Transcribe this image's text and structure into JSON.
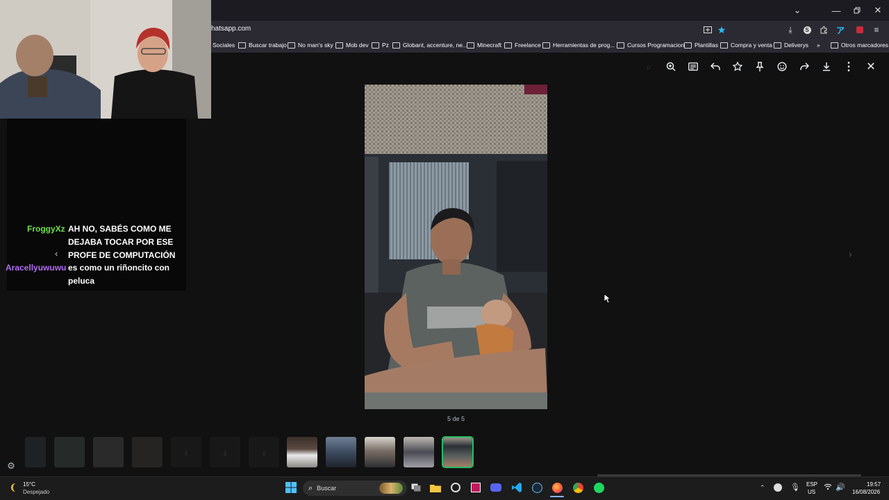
{
  "browser": {
    "url": "hatsapp.com",
    "bookmarks": [
      "Sociales",
      "Buscar trabajo",
      "No man's sky",
      "Mob dev",
      "Pz",
      "Globant, accenture, ne...",
      "Minecraft",
      "Freelance",
      "Herramientas de prog...",
      "Cursos Programacion",
      "Plantillas",
      "Compra y venta",
      "Deliverys",
      "Otros marcadores"
    ],
    "accent_color": "#2ac3ff"
  },
  "viewer": {
    "counter": "5 de 5",
    "selected_color": "#21c063"
  },
  "chat": {
    "messages": [
      {
        "user": "FroggyXz",
        "color": "#6fe24a",
        "text": "AH NO, SABÉS COMO ME DEJABA TOCAR POR ESE PROFE DE COMPUTACIÓN"
      },
      {
        "user": "Aracellyuwuwu",
        "color": "#b36cf5",
        "text": "es como un riñoncito con peluca"
      }
    ]
  },
  "taskbar": {
    "weather_temp": "15°C",
    "weather_desc": "Despejado",
    "search_label": "Buscar",
    "lang_top": "ESP",
    "lang_bottom": "US",
    "time": "19:57",
    "date": "16/08/2026"
  }
}
